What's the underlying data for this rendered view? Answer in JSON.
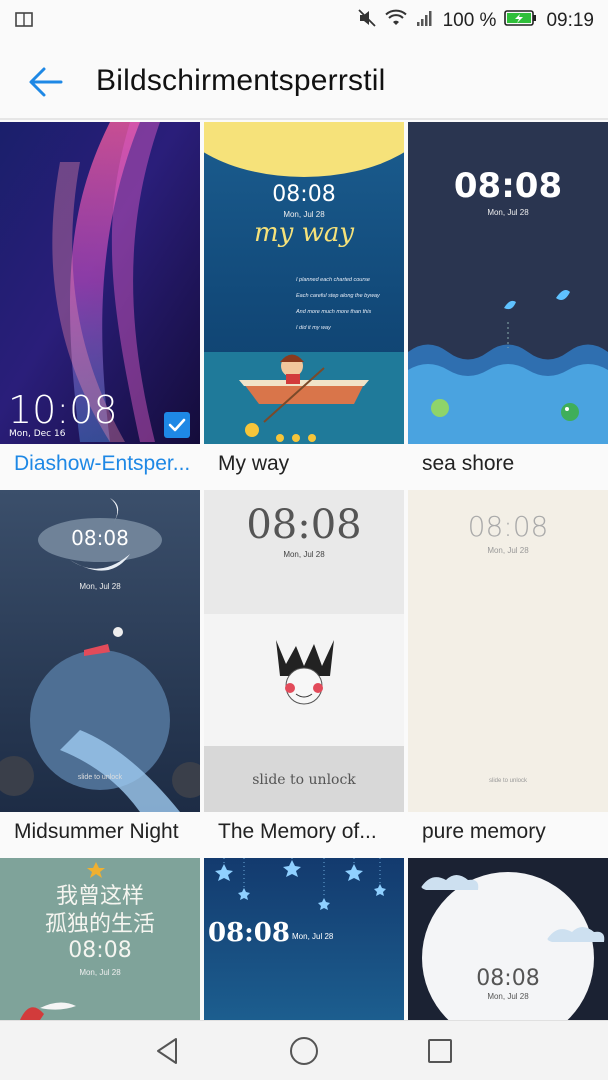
{
  "status": {
    "battery_percent": "100 %",
    "time": "09:19",
    "battery_level": 1.0
  },
  "header": {
    "title": "Bildschirmentsperrstil"
  },
  "tiles": [
    {
      "caption": "Diashow-Entsper...",
      "time": "10:08",
      "date": "Mon, Dec 16",
      "selected": true
    },
    {
      "caption": "My way",
      "time": "08:08",
      "date": "Mon,  Jul 28",
      "headline": "my way",
      "lines": [
        "I planned each charted course",
        "Each careful step along the byway",
        "And more much more than this",
        "I did it my way"
      ]
    },
    {
      "caption": "sea shore",
      "time": "08:08",
      "date": "Mon,  Jul 28"
    },
    {
      "caption": "Midsummer Night",
      "time": "08:08",
      "date": "Mon,  Jul 28",
      "hint": "slide to unlock"
    },
    {
      "caption": "The Memory of...",
      "time": "08:08",
      "date": "Mon,  Jul 28",
      "hint": "slide to unlock"
    },
    {
      "caption": "pure memory",
      "time": "08:08",
      "date": "Mon,  Jul 28",
      "hint": "slide to unlock"
    },
    {
      "caption": "",
      "time": "08:08",
      "date": "Mon,  Jul 28",
      "headline": "我曾这样",
      "headline2": "孤独的生活"
    },
    {
      "caption": "",
      "time": "08:08",
      "date": "Mon, Jul 28"
    },
    {
      "caption": "",
      "time": "08:08",
      "date": "Mon, Jul 28"
    }
  ]
}
